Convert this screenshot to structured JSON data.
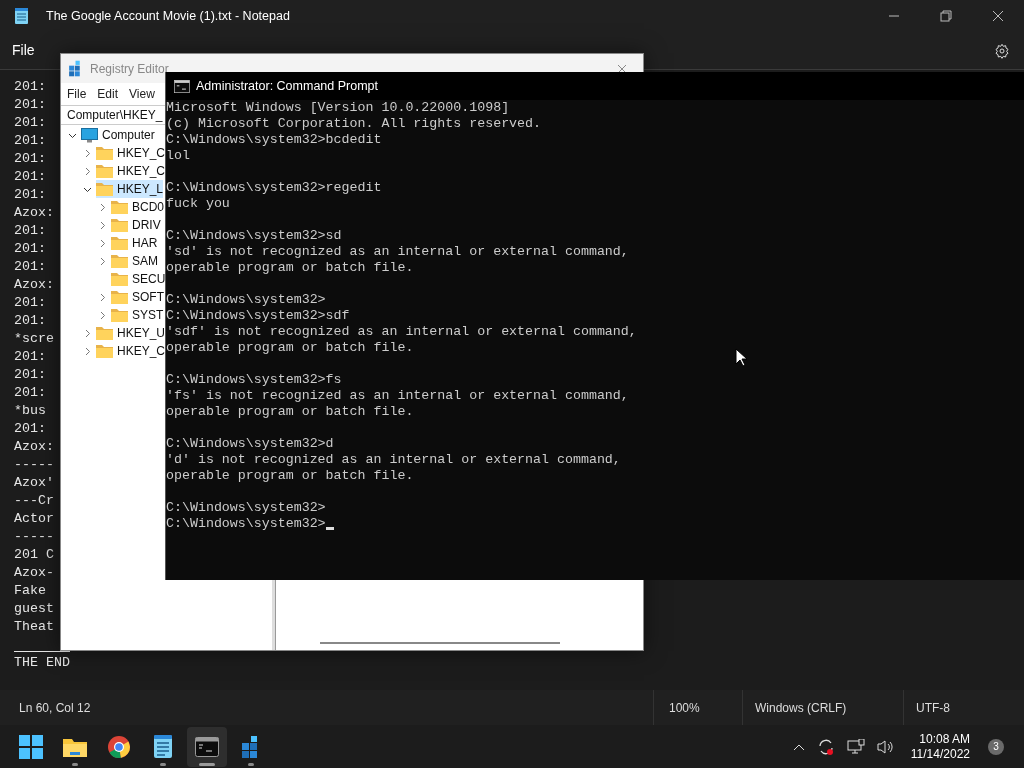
{
  "notepad": {
    "title": "The Google Account Movie (1).txt - Notepad",
    "menu": [
      "File"
    ],
    "lines": [
      "201:",
      "201:",
      "201:",
      "201:",
      "201:",
      "201:",
      "201:",
      "Azox:",
      "201:",
      "201:",
      "201:",
      "Azox:",
      "201:",
      "201:",
      "*scre",
      "201:",
      "201:",
      "201:",
      "*bus",
      "201:",
      "Azox:",
      "-----",
      "Azox'",
      "---Cr",
      "Actor",
      "-----",
      "201 C",
      "Azox-",
      "Fake",
      "guest",
      "Theat"
    ],
    "end_line": "THE END",
    "status": {
      "position": "Ln 60, Col 12",
      "zoom": "100%",
      "line_ending": "Windows (CRLF)",
      "encoding": "UTF-8"
    }
  },
  "registry": {
    "title": "Registry Editor",
    "menu": [
      "File",
      "Edit",
      "View"
    ],
    "address": "Computer\\HKEY_",
    "tree": [
      {
        "label": "Computer",
        "expanded": true,
        "selected": false,
        "children": [
          {
            "label": "HKEY_C",
            "expanded": false,
            "selected": false
          },
          {
            "label": "HKEY_C",
            "expanded": false,
            "selected": false
          },
          {
            "label": "HKEY_L",
            "expanded": true,
            "selected": true,
            "children": [
              {
                "label": "BCD0",
                "expanded": false,
                "selected": false
              },
              {
                "label": "DRIV",
                "expanded": false,
                "selected": false
              },
              {
                "label": "HAR",
                "expanded": false,
                "selected": false
              },
              {
                "label": "SAM",
                "expanded": false,
                "selected": false
              },
              {
                "label": "SECU",
                "selected": false
              },
              {
                "label": "SOFT",
                "expanded": false,
                "selected": false
              },
              {
                "label": "SYST",
                "expanded": false,
                "selected": false
              }
            ]
          },
          {
            "label": "HKEY_U",
            "expanded": false,
            "selected": false
          },
          {
            "label": "HKEY_C",
            "expanded": false,
            "selected": false
          }
        ]
      }
    ]
  },
  "cmd": {
    "title": "Administrator: Command Prompt",
    "blocks": [
      [
        "Microsoft Windows [Version 10.0.22000.1098]",
        "(c) Microsoft Corporation. All rights reserved.",
        "C:\\Windows\\system32>bcdedit",
        "lol"
      ],
      [
        "C:\\Windows\\system32>regedit",
        "fuck you"
      ],
      [
        "C:\\Windows\\system32>sd",
        "'sd' is not recognized as an internal or external command,",
        "operable program or batch file."
      ],
      [
        "C:\\Windows\\system32>",
        "C:\\Windows\\system32>sdf",
        "'sdf' is not recognized as an internal or external command,",
        "operable program or batch file."
      ],
      [
        "C:\\Windows\\system32>fs",
        "'fs' is not recognized as an internal or external command,",
        "operable program or batch file."
      ],
      [
        "C:\\Windows\\system32>d",
        "'d' is not recognized as an internal or external command,",
        "operable program or batch file."
      ],
      [
        "C:\\Windows\\system32>",
        "C:\\Windows\\system32>"
      ]
    ],
    "cursor": true
  },
  "taskbar": {
    "apps": [
      {
        "kind": "start",
        "running": false,
        "active": false
      },
      {
        "kind": "explorer",
        "running": true,
        "active": false
      },
      {
        "kind": "chrome",
        "running": false,
        "active": false
      },
      {
        "kind": "notepad",
        "running": true,
        "active": false
      },
      {
        "kind": "terminal",
        "running": true,
        "active": true
      },
      {
        "kind": "regedit",
        "running": true,
        "active": false
      }
    ],
    "time": "10:08 AM",
    "date": "11/14/2022",
    "notifications": "3"
  }
}
